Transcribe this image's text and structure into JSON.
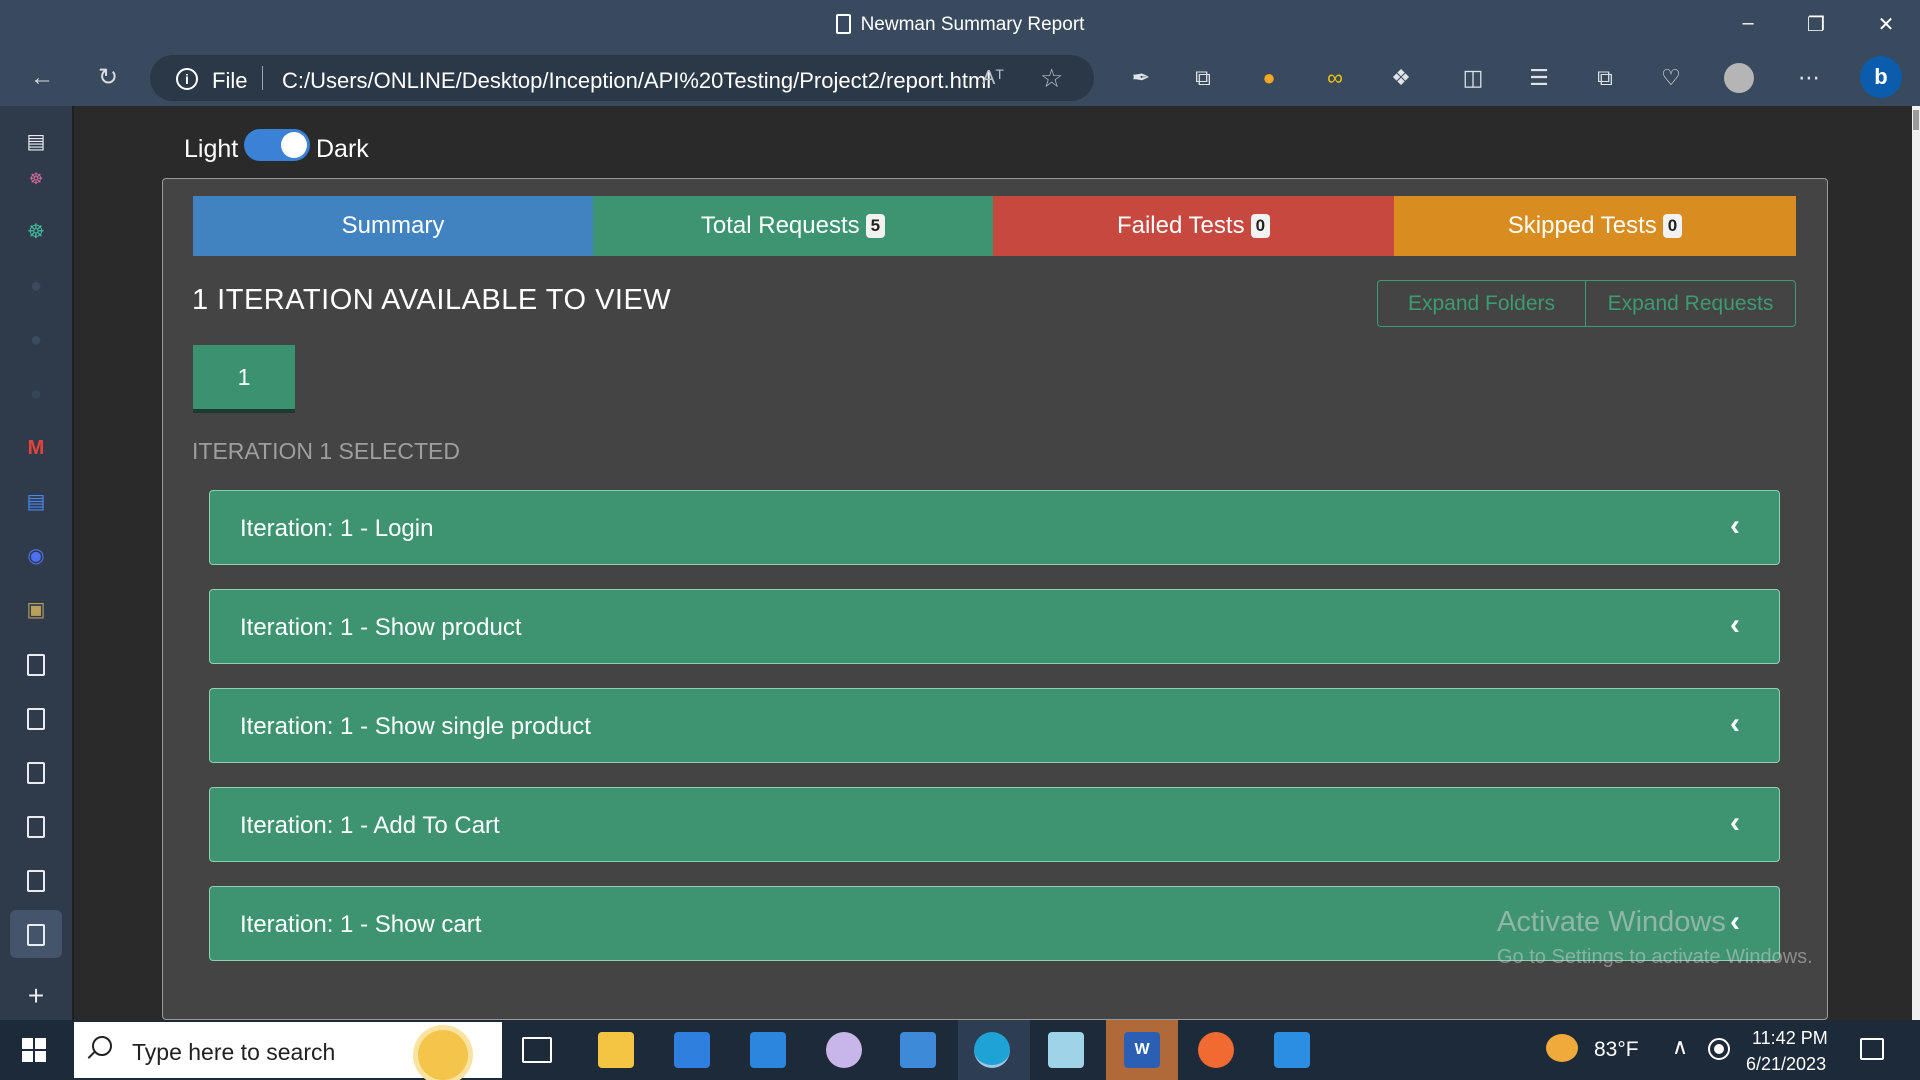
{
  "window": {
    "title": "Newman Summary Report",
    "controls": [
      "minimize-icon",
      "restore-icon",
      "close-icon"
    ]
  },
  "browser": {
    "url_scheme": "File",
    "url": "C:/Users/ONLINE/Desktop/Inception/API%20Testing/Project2/report.html",
    "read_aloud_glyph": "Aᵀ"
  },
  "report": {
    "theme_toggle": {
      "light_label": "Light",
      "dark_label": "Dark",
      "state": "dark"
    },
    "nav_tabs": [
      {
        "label": "Summary",
        "badge": null,
        "color": "#4183c0"
      },
      {
        "label": "Total Requests",
        "badge": "5",
        "color": "#3d9470"
      },
      {
        "label": "Failed Tests",
        "badge": "0",
        "color": "#c6483e"
      },
      {
        "label": "Skipped Tests",
        "badge": "0",
        "color": "#d98c20"
      }
    ],
    "iteration_heading": "1 ITERATION AVAILABLE TO VIEW",
    "expand_folders_label": "Expand Folders",
    "expand_requests_label": "Expand Requests",
    "iteration_button_label": "1",
    "iteration_selected_label": "ITERATION 1 SELECTED",
    "requests": [
      "Iteration: 1 - Login",
      "Iteration: 1 - Show product",
      "Iteration: 1 - Show single product",
      "Iteration: 1 - Add To Cart",
      "Iteration: 1 - Show cart"
    ]
  },
  "watermark": {
    "line1": "Activate Windows",
    "line2": "Go to Settings to activate Windows."
  },
  "taskbar": {
    "search_placeholder": "Type here to search",
    "temperature": "83°F",
    "time": "11:42 PM",
    "date": "6/21/2023"
  },
  "colors": {
    "accent_green": "#3e9471",
    "title_bar": "#3a4a5e",
    "panel_bg": "#444444"
  }
}
